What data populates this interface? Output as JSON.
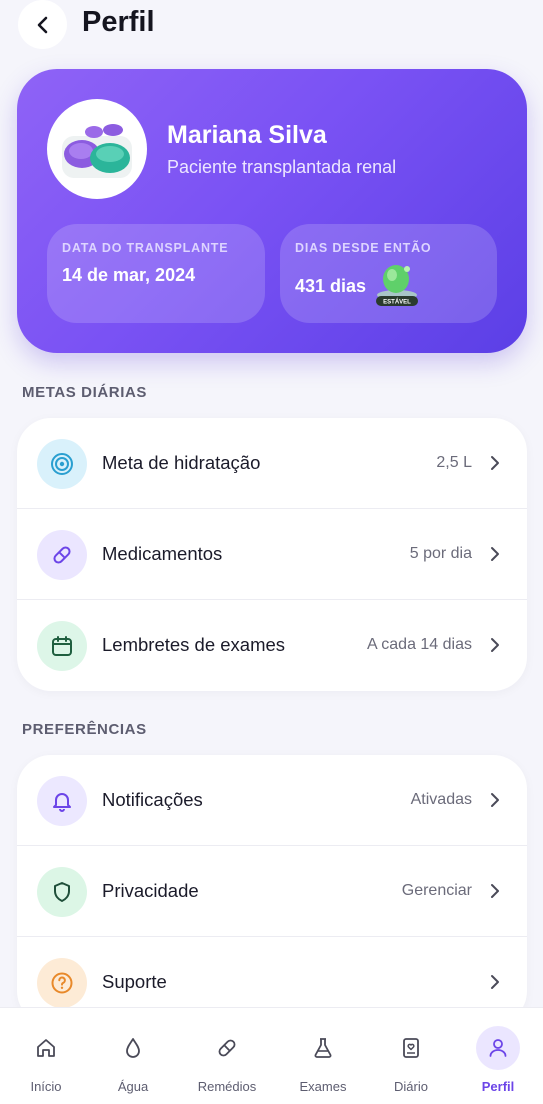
{
  "header": {
    "title": "Perfil"
  },
  "profile": {
    "name": "Mariana Silva",
    "subtitle": "Paciente transplantada renal",
    "transplant": {
      "label": "DATA DO TRANSPLANTE",
      "value": "14 de mar, 2024"
    },
    "days": {
      "label": "DIAS DESDE ENTÃO",
      "value": "431 dias",
      "badge_text": "ESTÁVEL"
    }
  },
  "sections": {
    "daily_goals": {
      "title": "METAS DIÁRIAS",
      "items": [
        {
          "label": "Meta de hidratação",
          "value": "2,5 L",
          "icon": "target-icon"
        },
        {
          "label": "Medicamentos",
          "value": "5 por dia",
          "icon": "pill-icon"
        },
        {
          "label": "Lembretes de exames",
          "value": "A cada 14 dias",
          "icon": "calendar-icon"
        }
      ]
    },
    "preferences": {
      "title": "PREFERÊNCIAS",
      "items": [
        {
          "label": "Notificações",
          "value": "Ativadas",
          "icon": "bell-icon"
        },
        {
          "label": "Privacidade",
          "value": "Gerenciar",
          "icon": "shield-icon"
        },
        {
          "label": "Suporte",
          "value": "",
          "icon": "help-icon"
        }
      ]
    }
  },
  "nav": {
    "items": [
      {
        "label": "Início",
        "icon": "home-icon"
      },
      {
        "label": "Água",
        "icon": "drop-icon"
      },
      {
        "label": "Remédios",
        "icon": "pill-icon"
      },
      {
        "label": "Exames",
        "icon": "flask-icon"
      },
      {
        "label": "Diário",
        "icon": "journal-icon"
      },
      {
        "label": "Perfil",
        "icon": "user-icon",
        "active": true
      }
    ]
  },
  "colors": {
    "accent": "#6c45e8",
    "card_gradient_start": "#8f63f6",
    "card_gradient_end": "#5b3fe6"
  }
}
